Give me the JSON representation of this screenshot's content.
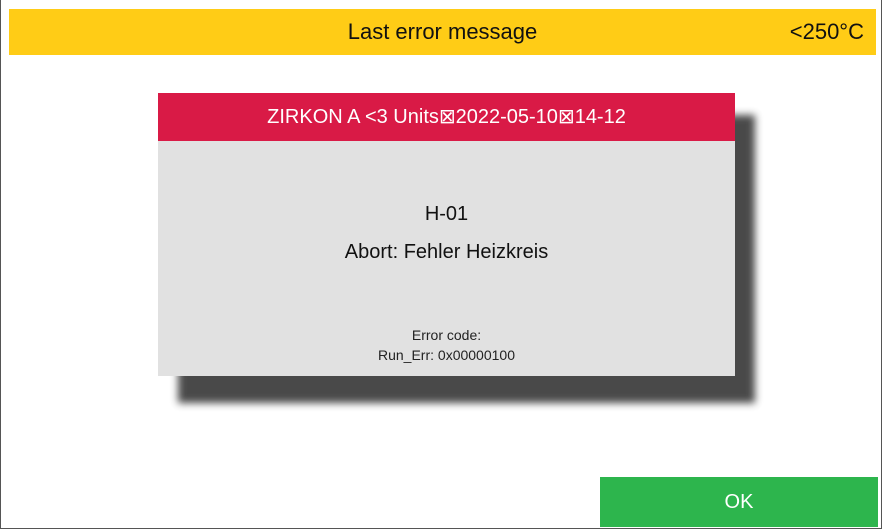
{
  "header": {
    "title": "Last error message",
    "temperature": "<250°C",
    "color": "#ffcc16"
  },
  "dialog": {
    "title": "ZIRKON A <3 Units⊠2022-05-10⊠14-12",
    "title_color": "#d91a46",
    "error_code": "H-01",
    "error_message": "Abort: Fehler Heizkreis",
    "detail_label": "Error code:",
    "detail_value": "Run_Err: 0x00000100"
  },
  "footer": {
    "ok_label": "OK",
    "ok_color": "#2db54d"
  }
}
